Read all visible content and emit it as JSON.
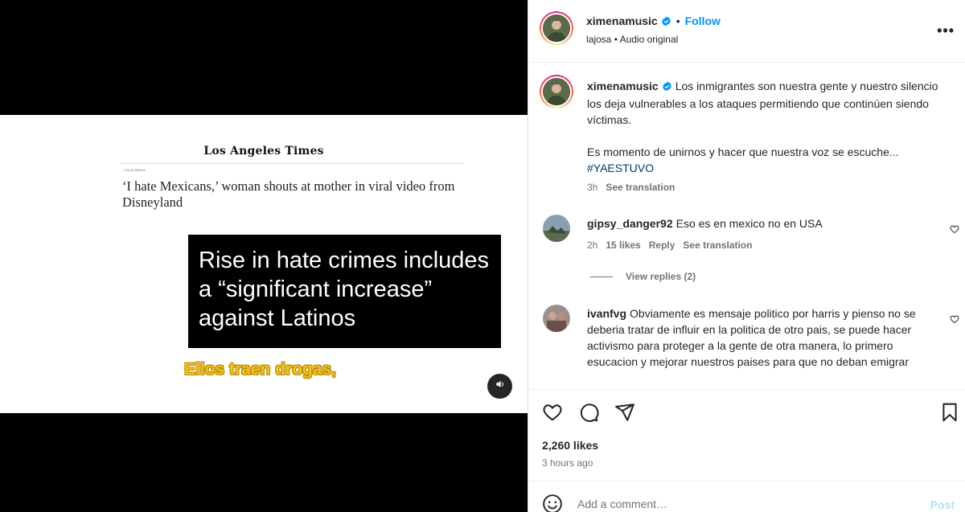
{
  "post": {
    "username": "ximenamusic",
    "follow_label": "Follow",
    "audio_user": "lajosa",
    "audio_label": "Audio original",
    "more_label": "•••"
  },
  "media": {
    "newspaper_name": "Los Angeles Times",
    "section": "CALIFORNIA",
    "headline": "‘I hate Mexicans,’ woman shouts at mother in viral video from Disneyland",
    "overlay_text": "Rise in hate crimes includes a “significant increase” against Latinos",
    "subtitle": "Ellos traen drogas,"
  },
  "caption": {
    "username": "ximenamusic",
    "text_1": "Los inmigrantes son nuestra gente y nuestro silencio los deja vulnerables a los ataques permitiendo que continúen siendo víctimas.",
    "text_2": "Es momento de unirnos y hacer que nuestra voz se escuche...",
    "hashtag": "#YAESTUVO",
    "time": "3h",
    "see_translation": "See translation"
  },
  "comments": [
    {
      "username": "gipsy_danger92",
      "text": "Eso es en mexico no en USA",
      "time": "2h",
      "likes": "15 likes",
      "reply": "Reply",
      "see_translation": "See translation",
      "view_replies": "View replies (2)"
    },
    {
      "username": "ivanfvg",
      "text": "Obviamente es mensaje politico por harris y pienso no se deberia tratar de influir en la politica de otro pais, se puede hacer activismo para proteger a la gente de otra manera, lo primero esucacion y mejorar nuestros paises para que no deban emigrar"
    }
  ],
  "stats": {
    "likes": "2,260 likes",
    "time_ago": "3 hours ago"
  },
  "composer": {
    "placeholder": "Add a comment…",
    "post_label": "Post"
  },
  "colors": {
    "accent": "#0095f6",
    "subtitle_yellow": "#f2c318",
    "muted": "#737373"
  }
}
